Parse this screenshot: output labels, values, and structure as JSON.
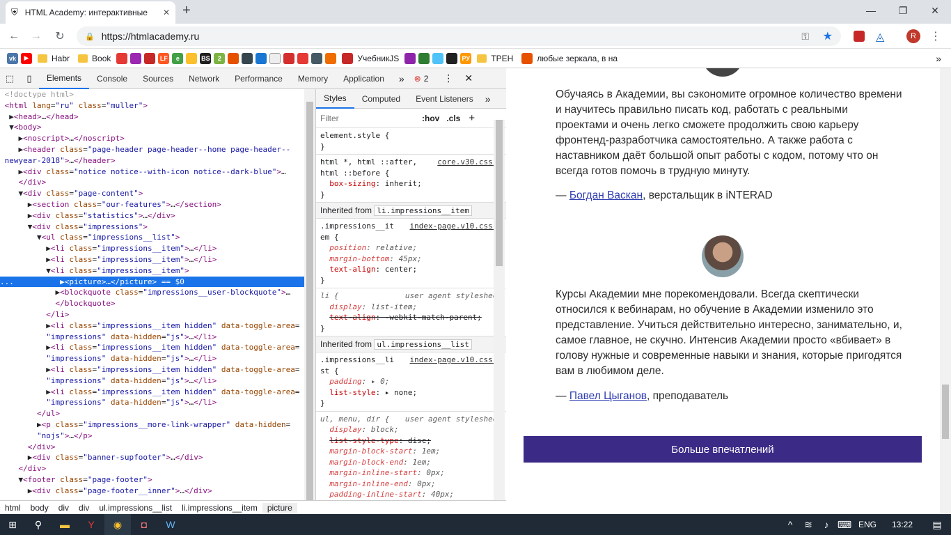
{
  "window": {
    "tab_title": "HTML Academy: интерактивные",
    "new_tab": "+",
    "min": "—",
    "max": "❐",
    "close": "✕",
    "url": "https://htmlacademy.ru",
    "profile": "R"
  },
  "bookmarks": [
    "Habr",
    "Book",
    "УчебникJS",
    "ТРЕН",
    "любые зеркала, в на"
  ],
  "devtools": {
    "tabs": [
      "Elements",
      "Console",
      "Sources",
      "Network",
      "Performance",
      "Memory",
      "Application"
    ],
    "more": "»",
    "errors": "2",
    "breadcrumb": [
      "html",
      "body",
      "div",
      "div",
      "ul.impressions__list",
      "li.impressions__item",
      "picture"
    ],
    "styles_tabs": [
      "Styles",
      "Computed",
      "Event Listeners"
    ],
    "filter_placeholder": "Filter",
    "hov": ":hov",
    "cls": ".cls",
    "add": "+"
  },
  "page": {
    "q1": "Обучаясь в Академии, вы сэкономите огромное количество времени и научитесь правильно писать код, работать с реальными проектами и очень легко сможете продолжить свою карьеру фронтенд-разработчика самостоятельно. А также работа с наставником даёт большой опыт работы с кодом, потому что он всегда готов помочь в трудную минуту.",
    "a1_dash": "— ",
    "a1_name": "Богдан Васкан",
    "a1_role": ", верстальщик в iNTERAD",
    "q2": "Курсы Академии мне порекомендовали. Всегда скептически относился к вебинарам, но обучение в Академии изменило это представление. Учиться действительно интересно, занимательно, и, самое главное, не скучно. Интенсив Академии просто «вбивает» в голову нужные и современные навыки и знания, которые пригодятся вам в любимом деле.",
    "a2_dash": "— ",
    "a2_name": "Павел Цыганов",
    "a2_role": ", преподаватель",
    "more_button": "Больше впечатлений"
  },
  "taskbar": {
    "lang": "ENG",
    "time": "13:22"
  }
}
